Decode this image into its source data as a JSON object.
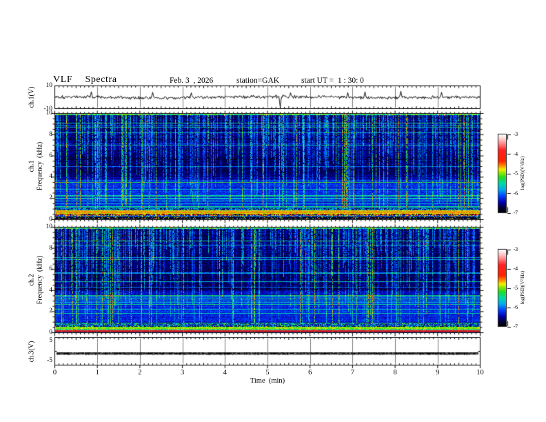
{
  "header": {
    "title": "VLF  Spectra",
    "date": "Feb. 3  , 2026",
    "station": "station=GAK",
    "start_ut": "start UT =  1 : 30: 0"
  },
  "x_axis": {
    "label": "Time  (min)",
    "ticks": [
      "0",
      "1",
      "2",
      "3",
      "4",
      "5",
      "6",
      "7",
      "8",
      "9",
      "10"
    ],
    "range_min": [
      0,
      10
    ]
  },
  "panels": {
    "ch1_wave": {
      "ylabel": "ch.1(V)",
      "ymax_label": "10",
      "ymin_label": "-10",
      "ylim": [
        -10,
        10
      ]
    },
    "ch1_spec": {
      "ylabel_line1": "ch.1",
      "ylabel_line2": "Frequency  (kHz)",
      "freq_ticks": [
        "10",
        "8",
        "6",
        "4",
        "2",
        "0"
      ],
      "ylim_kHz": [
        0,
        10
      ]
    },
    "ch2_spec": {
      "ylabel_line1": "ch.2",
      "ylabel_line2": "Frequency  (kHz)",
      "freq_ticks": [
        "10",
        "8",
        "6",
        "4",
        "2",
        "0"
      ],
      "ylim_kHz": [
        0,
        10
      ]
    },
    "ch3_wave": {
      "ylabel": "ch.3(V)",
      "ymax_label": "5",
      "ymin_label": "-5",
      "ylim": [
        -5,
        5
      ]
    }
  },
  "colorbar": {
    "label": "log(PSD)(V²/Hz)",
    "ticks": [
      "-3",
      "-4",
      "-5",
      "-6",
      "-7"
    ],
    "zlim_log_psd": [
      -7,
      -3
    ],
    "colormap": [
      {
        "t": 0.0,
        "c": "#000000"
      },
      {
        "t": 0.06,
        "c": "#000038"
      },
      {
        "t": 0.13,
        "c": "#0000b0"
      },
      {
        "t": 0.21,
        "c": "#0044ff"
      },
      {
        "t": 0.29,
        "c": "#00aaee"
      },
      {
        "t": 0.37,
        "c": "#00d8a8"
      },
      {
        "t": 0.45,
        "c": "#22dd22"
      },
      {
        "t": 0.51,
        "c": "#99e800"
      },
      {
        "t": 0.55,
        "c": "#f2ee00"
      },
      {
        "t": 0.6,
        "c": "#ff8800"
      },
      {
        "t": 0.66,
        "c": "#ff2200"
      },
      {
        "t": 0.8,
        "c": "#ff2222"
      },
      {
        "t": 0.88,
        "c": "#ff8888"
      },
      {
        "t": 0.94,
        "c": "#ffcccc"
      },
      {
        "t": 1.0,
        "c": "#ffffff"
      }
    ]
  },
  "chart_data": [
    {
      "type": "line",
      "name": "ch1 waveform",
      "ylabel": "ch.1(V)",
      "xlim_min": [
        0,
        10
      ],
      "ylim_V": [
        -10,
        10
      ],
      "description": "broadband noise around 0 V, ~±2 V, occasional spikes",
      "seed": 101,
      "noise_amplitude_V": 1.5,
      "slow_mod_V": 0.45,
      "spikes": [
        {
          "t_min": 0.85,
          "v": 5.0
        },
        {
          "t_min": 2.3,
          "v": 4.5
        },
        {
          "t_min": 3.2,
          "v": 4.0
        },
        {
          "t_min": 5.3,
          "v": -9.0
        },
        {
          "t_min": 5.55,
          "v": 4.0
        },
        {
          "t_min": 6.9,
          "v": 4.2
        },
        {
          "t_min": 7.3,
          "v": 5.0
        },
        {
          "t_min": 8.15,
          "v": 5.5
        },
        {
          "t_min": 9.1,
          "v": 4.5
        }
      ]
    },
    {
      "type": "heatmap",
      "name": "ch1 spectrogram",
      "ylabel": "Frequency (kHz)",
      "xlim_min": [
        0,
        10
      ],
      "ylim_kHz": [
        0,
        10
      ],
      "zlim_log_psd": [
        -7,
        -3
      ],
      "description": "dark-blue noise floor, vertical green/cyan impulsive streaks, blue horizontal banding below 4 kHz, strong yellow/red band near 0.6-0.9 kHz, dark-red band 0.4-0.55 kHz, speckle below 0.3 kHz",
      "seed": 7,
      "background_u": 0.06,
      "stripe_prob_low": 0.26,
      "stripe_prob_high": 0.1,
      "streaks": {
        "strong_prob": 0.07,
        "strong_amp": 0.4,
        "medium_prob": 0.45,
        "medium_amp": 0.24
      },
      "red_speck_prob": 0.00025,
      "top_red_prob": 0.0006,
      "bands": [
        {
          "f_lo": 0.88,
          "f_hi": 1.05,
          "u": 0.32,
          "spread": 0.1,
          "mode": "speckle"
        },
        {
          "f_lo": 0.58,
          "f_hi": 0.88,
          "u": 0.55,
          "spread": 0.05,
          "mode": "solid"
        },
        {
          "f_lo": 0.7,
          "f_hi": 0.78,
          "u": 0.67,
          "spread": 0.03,
          "mode": "solid"
        },
        {
          "f_lo": 0.36,
          "f_hi": 0.55,
          "u": 0.6,
          "spread": 0.1,
          "mode": "speckle"
        },
        {
          "f_lo": 0.04,
          "f_hi": 0.3,
          "u": 0.38,
          "spread": 0.28,
          "mode": "sparse"
        }
      ]
    },
    {
      "type": "heatmap",
      "name": "ch2 spectrogram",
      "ylabel": "Frequency (kHz)",
      "xlim_min": [
        0,
        10
      ],
      "ylim_kHz": [
        0,
        10
      ],
      "zlim_log_psd": [
        -7,
        -3
      ],
      "description": "similar noise floor and streaks, bright green band 0.3-0.55 kHz, thin red line ~0.2 kHz, red blobs near 9-10 kHz",
      "seed": 4242,
      "background_u": 0.06,
      "stripe_prob_low": 0.24,
      "stripe_prob_high": 0.1,
      "streaks": {
        "strong_prob": 0.06,
        "strong_amp": 0.4,
        "medium_prob": 0.46,
        "medium_amp": 0.24
      },
      "red_speck_prob": 0.0003,
      "top_red_prob": 0.003,
      "bands": [
        {
          "f_lo": 0.55,
          "f_hi": 0.88,
          "u": 0.34,
          "spread": 0.18,
          "mode": "speckle"
        },
        {
          "f_lo": 0.3,
          "f_hi": 0.55,
          "u": 0.5,
          "spread": 0.07,
          "mode": "solid"
        },
        {
          "f_lo": 0.12,
          "f_hi": 0.24,
          "u": 0.7,
          "spread": 0.04,
          "mode": "solid"
        },
        {
          "f_lo": 0.0,
          "f_hi": 0.1,
          "u": 0.05,
          "spread": 0.02,
          "mode": "solid"
        }
      ]
    },
    {
      "type": "line",
      "name": "ch3 waveform",
      "ylabel": "ch.3(V)",
      "xlim_min": [
        0,
        10
      ],
      "ylim_V": [
        -5,
        5
      ],
      "description": "flat saturated trace near -0.8 V for whole record",
      "seed": 55,
      "value_V": -0.8,
      "thickness_V": 0.8
    }
  ]
}
